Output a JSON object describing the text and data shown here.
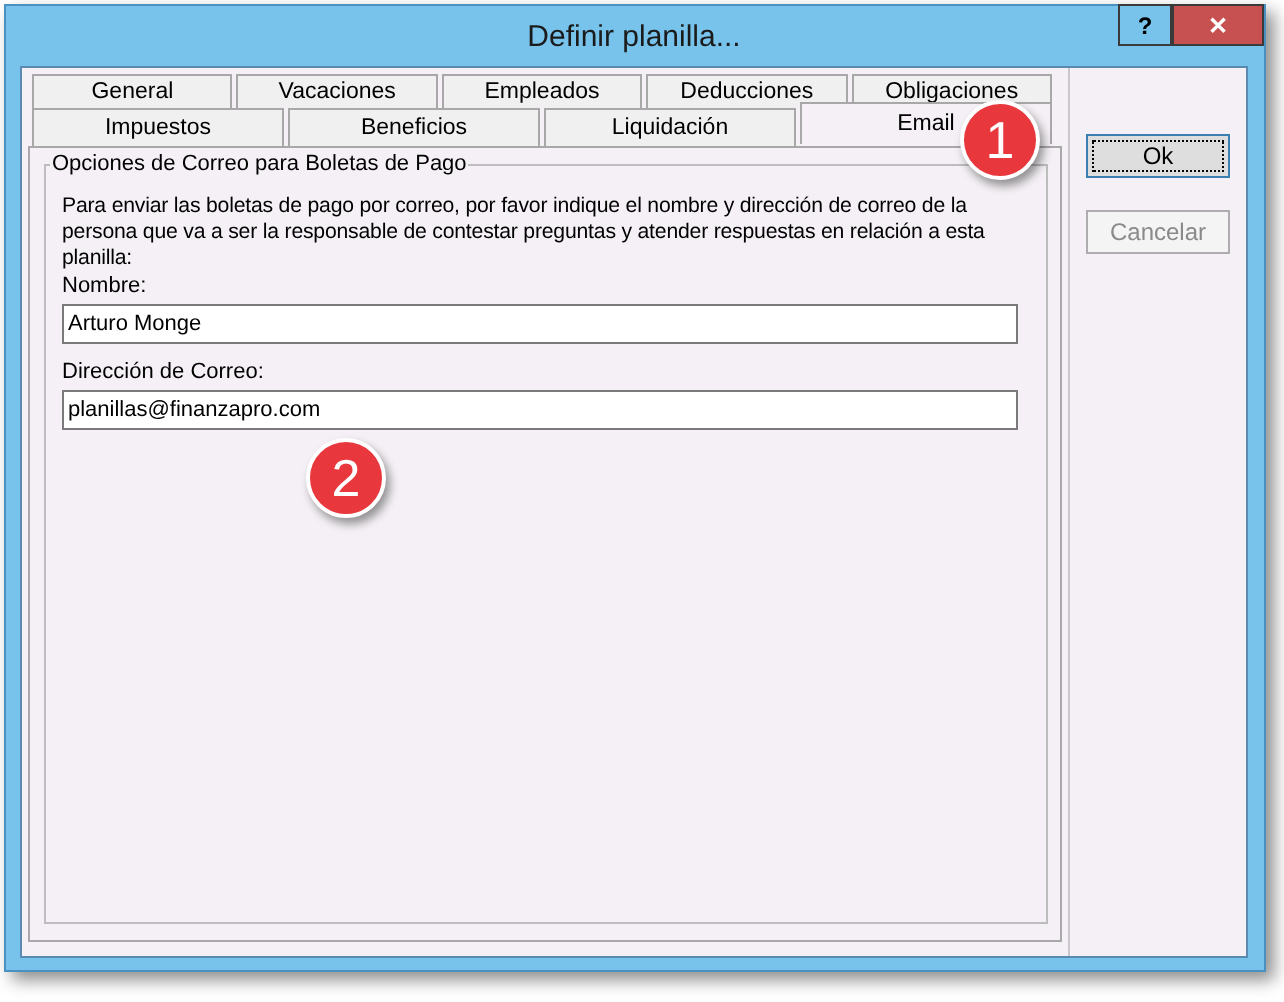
{
  "window": {
    "title": "Definir planilla...",
    "help_button": "?",
    "close_button": "✕"
  },
  "tab_rows": [
    [
      {
        "label": "General",
        "selected": false
      },
      {
        "label": "Vacaciones",
        "selected": false
      },
      {
        "label": "Empleados",
        "selected": false
      },
      {
        "label": "Deducciones",
        "selected": false
      },
      {
        "label": "Obligaciones",
        "selected": false
      }
    ],
    [
      {
        "label": "Impuestos",
        "selected": false
      },
      {
        "label": "Beneficios",
        "selected": false
      },
      {
        "label": "Liquidación",
        "selected": false
      },
      {
        "label": "Email",
        "selected": true
      }
    ]
  ],
  "group": {
    "title": "Opciones de Correo para Boletas de Pago",
    "description": "Para enviar las boletas de pago por correo, por favor indique el nombre y dirección de correo de la persona que va a ser la responsable de contestar preguntas y atender respuestas en relación a esta planilla:",
    "fields": [
      {
        "label": "Nombre:",
        "value": "Arturo Monge"
      },
      {
        "label": "Dirección de Correo:",
        "value": "planillas@finanzapro.com"
      }
    ]
  },
  "buttons": [
    {
      "label": "Ok",
      "disabled": false
    },
    {
      "label": "Cancelar",
      "disabled": true
    }
  ],
  "callouts": [
    "1",
    "2"
  ]
}
